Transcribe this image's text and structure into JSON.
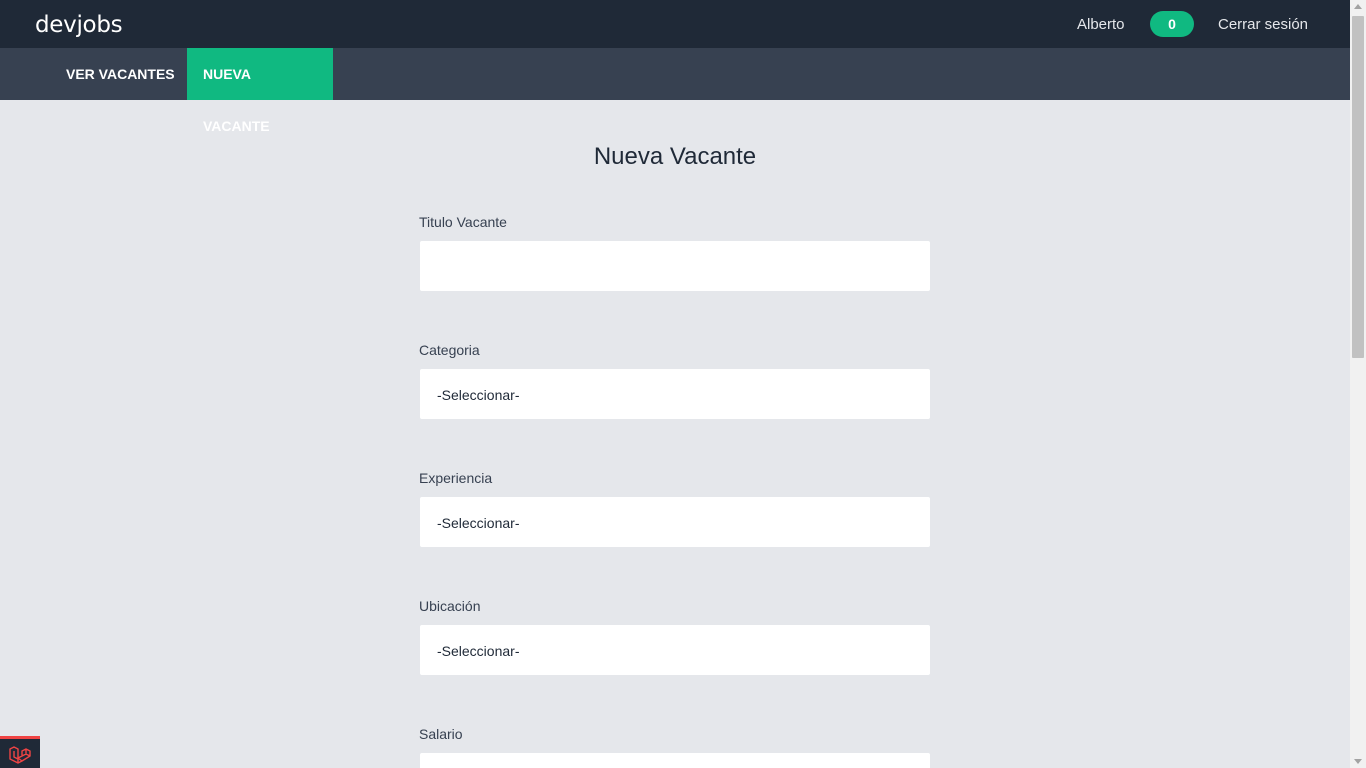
{
  "header": {
    "logo": "devjobs",
    "user_name": "Alberto",
    "notifications_count": "0",
    "logout_label": "Cerrar sesión"
  },
  "nav": {
    "items": [
      {
        "label": "Ver Vacantes",
        "active": false
      },
      {
        "label": "Nueva Vacante",
        "active": true
      }
    ]
  },
  "form": {
    "title": "Nueva Vacante",
    "fields": [
      {
        "label": "Titulo Vacante",
        "type": "text",
        "value": ""
      },
      {
        "label": "Categoria",
        "type": "select",
        "value": "-Seleccionar-"
      },
      {
        "label": "Experiencia",
        "type": "select",
        "value": "-Seleccionar-"
      },
      {
        "label": "Ubicación",
        "type": "select",
        "value": "-Seleccionar-"
      },
      {
        "label": "Salario",
        "type": "select",
        "value": ""
      }
    ]
  },
  "colors": {
    "header_bg": "#1f2937",
    "nav_bg": "#374151",
    "accent": "#10b981",
    "page_bg": "#e5e7eb"
  },
  "icons": {
    "debug_bar": "laravel-logo-icon"
  }
}
